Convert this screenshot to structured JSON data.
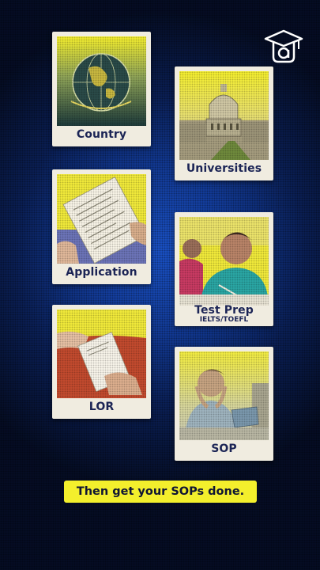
{
  "cards": [
    {
      "id": "country",
      "label": "Country",
      "icon": "globe-icon"
    },
    {
      "id": "universities",
      "label": "Universities",
      "icon": "campus-icon"
    },
    {
      "id": "application",
      "label": "Application",
      "icon": "form-icon"
    },
    {
      "id": "test_prep",
      "label": "Test Prep",
      "sublabel": "IELTS/TOEFL",
      "icon": "student-writing-icon"
    },
    {
      "id": "lor",
      "label": "LOR",
      "icon": "letter-icon"
    },
    {
      "id": "sop",
      "label": "SOP",
      "icon": "stressed-student-icon"
    }
  ],
  "banner": {
    "text": "Then get your SOPs done."
  },
  "logo": {
    "icon": "graduation-cap-logo-icon"
  },
  "colors": {
    "accent_yellow": "#f3ef2c",
    "background_blue": "#123a96",
    "caption_navy": "#1b2455"
  }
}
